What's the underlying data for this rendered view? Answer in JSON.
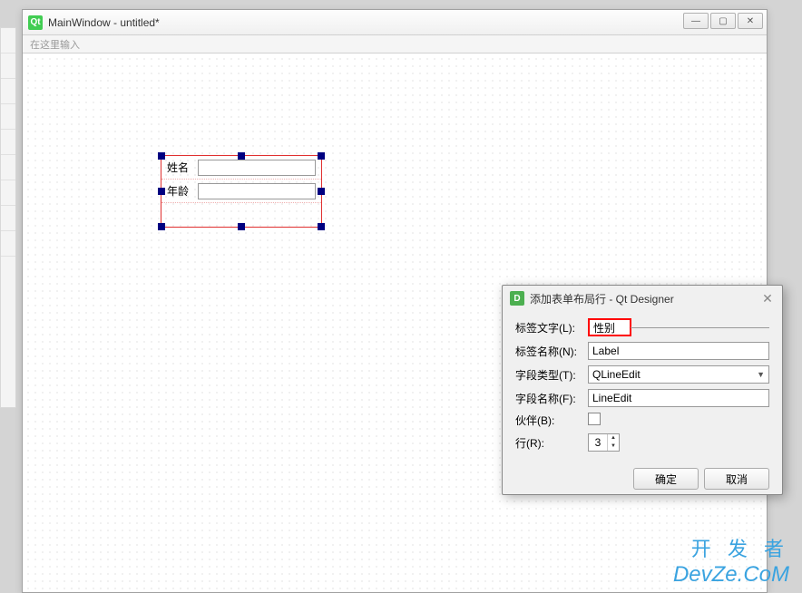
{
  "window": {
    "title": "MainWindow - untitled*",
    "menu_hint": "在这里输入"
  },
  "form_layout": {
    "rows": [
      {
        "label": "姓名"
      },
      {
        "label": "年龄"
      }
    ]
  },
  "dialog": {
    "title": "添加表单布局行 - Qt Designer",
    "fields": {
      "label_text": {
        "label": "标签文字(L):",
        "value": "性别"
      },
      "label_name": {
        "label": "标签名称(N):",
        "value": "Label"
      },
      "field_type": {
        "label": "字段类型(T):",
        "value": "QLineEdit"
      },
      "field_name": {
        "label": "字段名称(F):",
        "value": "LineEdit"
      },
      "buddy": {
        "label": "伙伴(B):",
        "checked": false
      },
      "row": {
        "label": "行(R):",
        "value": "3"
      }
    },
    "buttons": {
      "ok": "确定",
      "cancel": "取消"
    }
  },
  "watermark": {
    "line1": "开 发 者",
    "line2": "DevZe.CoM"
  }
}
